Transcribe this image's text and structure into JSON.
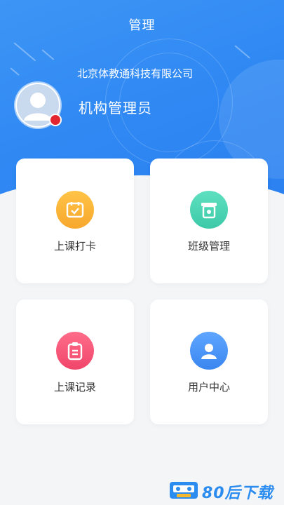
{
  "header": {
    "title": "管理"
  },
  "profile": {
    "company": "北京体教通科技有限公司",
    "role": "机构管理员"
  },
  "menu": [
    {
      "label": "上课打卡",
      "icon": "calendar-check-icon",
      "color": "#f7a72c"
    },
    {
      "label": "班级管理",
      "icon": "class-board-icon",
      "color": "#3cc9a8"
    },
    {
      "label": "上课记录",
      "icon": "clipboard-icon",
      "color": "#f0456a"
    },
    {
      "label": "用户中心",
      "icon": "user-icon",
      "color": "#3a86f0"
    }
  ],
  "watermark": {
    "text": "80后下载"
  },
  "colors": {
    "primary": "#2f88f3",
    "background": "#f4f5f7"
  }
}
